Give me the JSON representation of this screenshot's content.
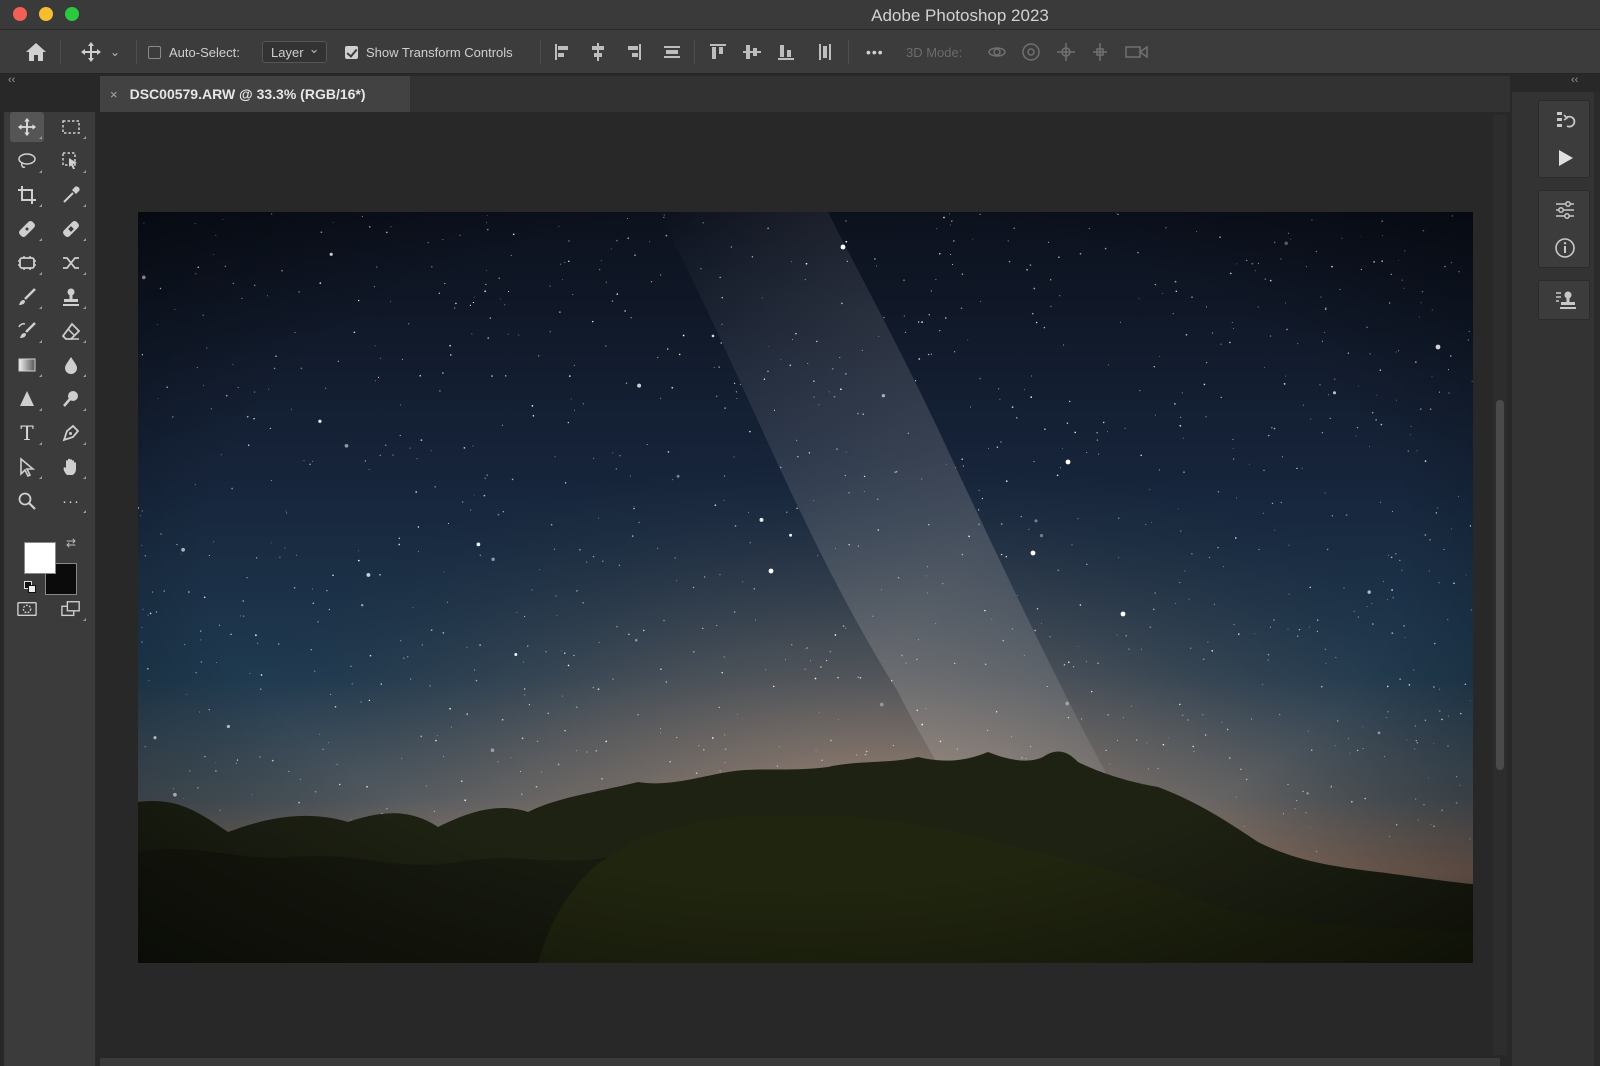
{
  "window": {
    "title": "Adobe Photoshop 2023"
  },
  "options_bar": {
    "auto_select_label": "Auto-Select:",
    "auto_select_checked": false,
    "auto_select_target": "Layer",
    "show_transform_label": "Show Transform Controls",
    "show_transform_checked": true,
    "more_label": "•••",
    "mode_3d_label": "3D Mode:",
    "icons": [
      "home-icon",
      "move-tool-icon",
      "align-left-edges-icon",
      "align-horizontal-centers-icon",
      "align-right-edges-icon",
      "distribute-vertically-icon",
      "align-top-edges-icon",
      "align-vertical-centers-icon",
      "align-bottom-edges-icon",
      "distribute-horizontally-icon",
      "orbit-3d-icon",
      "roll-3d-icon",
      "drag-3d-icon",
      "slide-3d-icon",
      "scale-3d-icon"
    ]
  },
  "document": {
    "tab_label": "DSC00579.ARW @ 33.3% (RGB/16*)",
    "close_glyph": "×",
    "zoom": "33.3%",
    "color_mode": "RGB/16*",
    "filename": "DSC00579.ARW"
  },
  "panel_collapse": {
    "left": "‹‹",
    "right": "‹‹"
  },
  "toolbar": {
    "tools": [
      {
        "name": "move-tool",
        "active": true
      },
      {
        "name": "rectangular-marquee-tool",
        "active": false
      },
      {
        "name": "lasso-tool",
        "active": false
      },
      {
        "name": "object-selection-tool",
        "active": false
      },
      {
        "name": "crop-tool",
        "active": false
      },
      {
        "name": "eyedropper-tool",
        "active": false
      },
      {
        "name": "spot-healing-brush-tool",
        "active": false
      },
      {
        "name": "healing-brush-tool",
        "active": false
      },
      {
        "name": "patch-tool",
        "active": false
      },
      {
        "name": "content-aware-move-tool",
        "active": false
      },
      {
        "name": "brush-tool",
        "active": false
      },
      {
        "name": "clone-stamp-tool",
        "active": false
      },
      {
        "name": "history-brush-tool",
        "active": false
      },
      {
        "name": "eraser-tool",
        "active": false
      },
      {
        "name": "gradient-tool",
        "active": false
      },
      {
        "name": "blur-tool",
        "active": false
      },
      {
        "name": "sharpen-tool",
        "active": false
      },
      {
        "name": "dodge-tool",
        "active": false
      },
      {
        "name": "type-tool",
        "active": false
      },
      {
        "name": "pen-tool",
        "active": false
      },
      {
        "name": "path-selection-tool",
        "active": false
      },
      {
        "name": "hand-tool",
        "active": false
      },
      {
        "name": "zoom-tool",
        "active": false
      },
      {
        "name": "edit-toolbar",
        "active": false
      }
    ],
    "type_glyph": "T",
    "more_glyph": "···",
    "foreground_color": "#ffffff",
    "background_color": "#0b0b0b"
  },
  "right_panels": {
    "icons": [
      "history-icon",
      "actions-play-icon",
      "adjustments-icon",
      "info-icon",
      "clone-source-icon"
    ]
  },
  "image": {
    "subject": "night sky with milky way over tree line",
    "colors": {
      "sky_top": "#0d1220",
      "sky_mid": "#1d3346",
      "horizon_glow": "#b58e74",
      "trees": "#1a1e10"
    }
  }
}
